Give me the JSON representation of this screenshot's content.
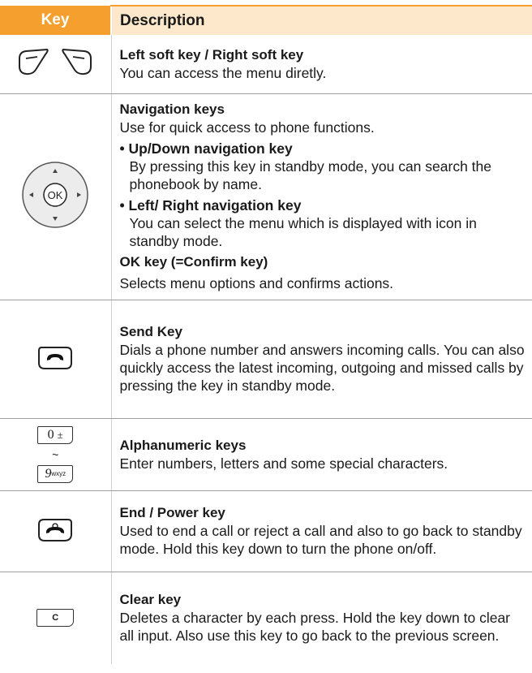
{
  "header": {
    "key": "Key",
    "description": "Description"
  },
  "rows": [
    {
      "title": "Left soft key / Right soft key",
      "body": "You can access the menu diretly."
    },
    {
      "title": "Navigation keys",
      "body": "Use for quick access to phone functions.",
      "bullet1_title": "• Up/Down navigation key",
      "bullet1_body": "By pressing this key in standby mode, you can search the phonebook by name.",
      "bullet2_title": "• Left/ Right navigation key",
      "bullet2_body": "You can select the menu which is displayed with icon in standby mode.",
      "ok_title": "OK key (=Confirm key)",
      "ok_body": "Selects menu options and confirms actions.",
      "ok_label": "OK"
    },
    {
      "title": "Send Key",
      "body": "Dials a phone number and answers incoming calls. You can also quickly access the latest incoming, outgoing and  missed calls by pressing the key in standby mode."
    },
    {
      "title": "Alphanumeric keys",
      "body": "Enter numbers, letters and some special characters.",
      "key_top": "0",
      "key_top_symbol": "±",
      "key_tilde": "~",
      "key_bottom": "9",
      "key_bottom_letters": "wxyz"
    },
    {
      "title": "End / Power key",
      "body": "Used to end a call or reject a call and also to go back to standby mode. Hold this key down to turn the phone on/off."
    },
    {
      "title": "Clear key",
      "body": "Deletes a character by each press. Hold the key down to clear all input. Also use this key to go back to the previous screen.",
      "key_label": "C"
    }
  ],
  "colors": {
    "header_key_bg": "#f5a02e",
    "header_desc_bg": "#fde8cc"
  }
}
